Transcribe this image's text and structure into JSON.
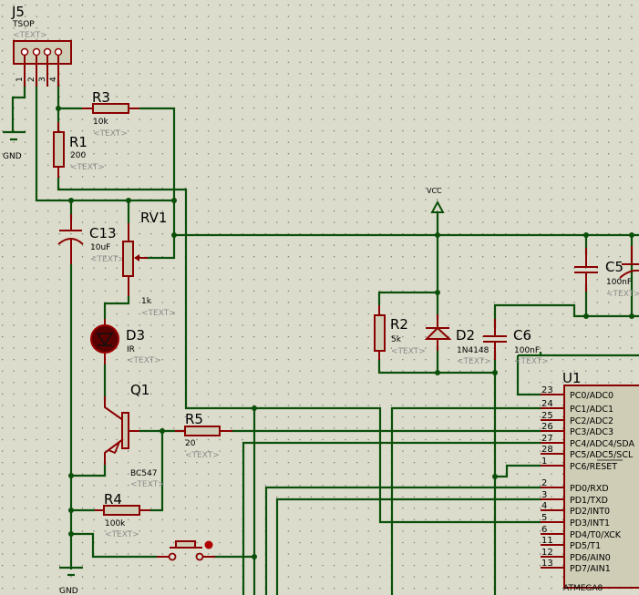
{
  "colors": {
    "background": "#dcdccc",
    "wire": "#0a4f0a",
    "component": "#8a0000",
    "component_fill": "#cfcdb5",
    "placeholder_text": "#8c8c8c"
  },
  "components": {
    "j5": {
      "ref": "J5",
      "value": "TSOP",
      "text": "<TEXT>",
      "pins": [
        "1",
        "2",
        "3",
        "4"
      ]
    },
    "r3": {
      "ref": "R3",
      "value": "10k",
      "text": "<TEXT>"
    },
    "r1": {
      "ref": "R1",
      "value": "200",
      "text": "<TEXT>"
    },
    "c13": {
      "ref": "C13",
      "value": "10uF",
      "text": "<TEXT>"
    },
    "rv1": {
      "ref": "RV1",
      "value": "1k",
      "text": "<TEXT>"
    },
    "d3": {
      "ref": "D3",
      "value": "IR",
      "text": "<TEXT>"
    },
    "q1": {
      "ref": "Q1",
      "value": "BC547",
      "text": "<TEXT>"
    },
    "r5": {
      "ref": "R5",
      "value": "20",
      "text": "<TEXT>"
    },
    "r4": {
      "ref": "R4",
      "value": "100k",
      "text": "<TEXT>"
    },
    "r2": {
      "ref": "R2",
      "value": "5k",
      "text": "<TEXT>"
    },
    "d2": {
      "ref": "D2",
      "value": "1N4148",
      "text": "<TEXT>"
    },
    "c6": {
      "ref": "C6",
      "value": "100nF",
      "text": "<TEXT>"
    },
    "c5": {
      "ref": "C5",
      "value": "100nF",
      "text": "<TEXT>"
    },
    "u1": {
      "ref": "U1",
      "value": "ATMEGA8",
      "pins": [
        {
          "num": "23",
          "label": "PC0/ADC0"
        },
        {
          "num": "24",
          "label": "PC1/ADC1"
        },
        {
          "num": "25",
          "label": "PC2/ADC2"
        },
        {
          "num": "26",
          "label": "PC3/ADC3"
        },
        {
          "num": "27",
          "label": "PC4/ADC4/SDA"
        },
        {
          "num": "28",
          "label": "PC5/ADC5/SCL"
        },
        {
          "num": "1",
          "label": "PC6/RESET"
        },
        {
          "num": "2",
          "label": "PD0/RXD"
        },
        {
          "num": "3",
          "label": "PD1/TXD"
        },
        {
          "num": "4",
          "label": "PD2/INT0"
        },
        {
          "num": "5",
          "label": "PD3/INT1"
        },
        {
          "num": "6",
          "label": "PD4/T0/XCK"
        },
        {
          "num": "11",
          "label": "PD5/T1"
        },
        {
          "num": "12",
          "label": "PD6/AIN0"
        },
        {
          "num": "13",
          "label": "PD7/AIN1"
        }
      ]
    }
  },
  "power": {
    "gnd_top": "GND",
    "gnd_bottom": "GND",
    "vcc": "VCC"
  }
}
